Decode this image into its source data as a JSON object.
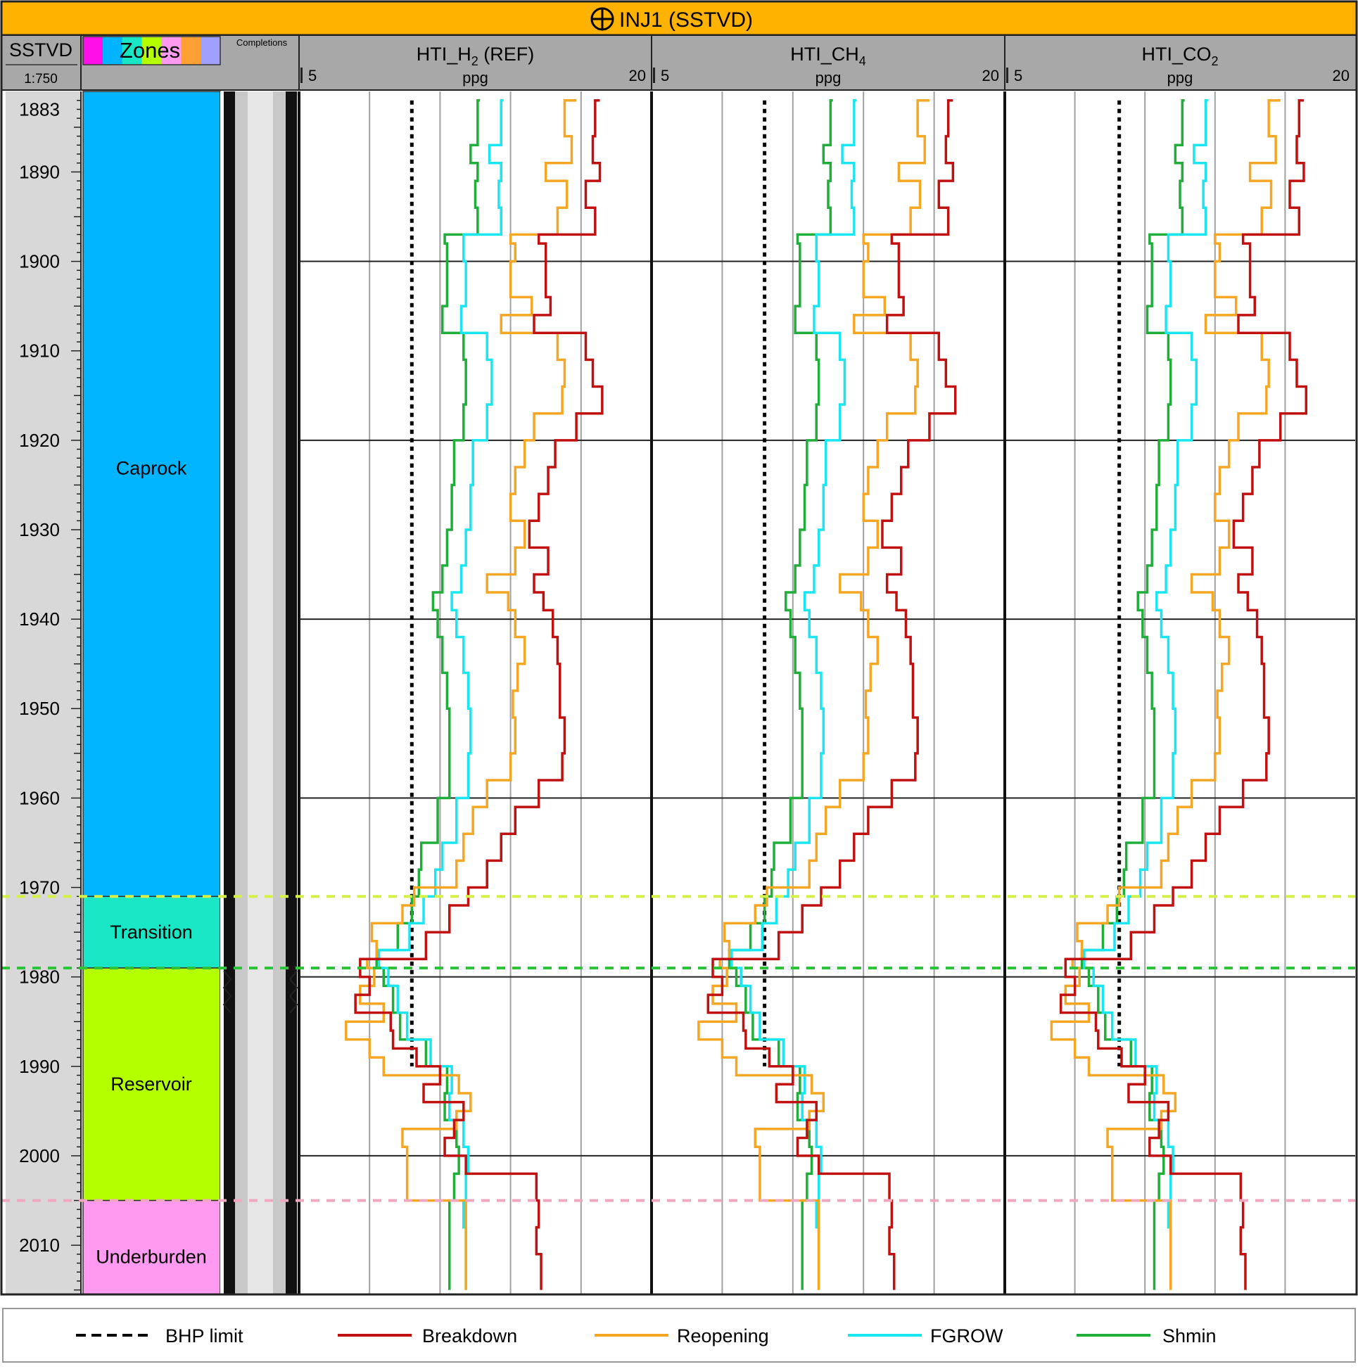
{
  "header": {
    "title": "INJ1 (SSTVD)",
    "color": "#FFB300"
  },
  "depth_track": {
    "label": "SSTVD",
    "scale": "1:750"
  },
  "zones_track": {
    "label": "Zones",
    "swatches": [
      "#FF10E6",
      "#00B4FF",
      "#18E6C4",
      "#B4FF00",
      "#FF9AF0",
      "#FFA033",
      "#A0A0FF"
    ]
  },
  "completions_track": {
    "label": "Completions"
  },
  "tracks": [
    {
      "title_parts": [
        "HTI_H",
        "2",
        " (REF)"
      ],
      "unit": "ppg",
      "min": "5",
      "max": "20"
    },
    {
      "title_parts": [
        "HTI_CH",
        "4",
        ""
      ],
      "unit": "ppg",
      "min": "5",
      "max": "20"
    },
    {
      "title_parts": [
        "HTI_CO",
        "2",
        ""
      ],
      "unit": "ppg",
      "min": "5",
      "max": "20"
    }
  ],
  "legend": [
    {
      "label": "BHP limit",
      "color": "#000000",
      "dashed": true
    },
    {
      "label": "Breakdown",
      "color": "#C01010",
      "dashed": false
    },
    {
      "label": "Reopening",
      "color": "#F5A623",
      "dashed": false
    },
    {
      "label": "FGROW",
      "color": "#19E6F0",
      "dashed": false
    },
    {
      "label": "Shmin",
      "color": "#1FAE3A",
      "dashed": false
    }
  ],
  "chart_data": {
    "type": "line",
    "depth_range": [
      1881,
      2015.5
    ],
    "x_range": [
      5,
      20
    ],
    "depth_ticks": [
      1883,
      1890,
      1900,
      1910,
      1920,
      1930,
      1940,
      1950,
      1960,
      1970,
      1980,
      1990,
      2000,
      2010
    ],
    "zones": [
      {
        "name": "Caprock",
        "top": 1881,
        "bottom": 1971,
        "color": "#00B4FF"
      },
      {
        "name": "Transition",
        "top": 1971,
        "bottom": 1979,
        "color": "#18E6C4"
      },
      {
        "name": "Reservoir",
        "top": 1979,
        "bottom": 2005,
        "color": "#B4FF00"
      },
      {
        "name": "Underburden",
        "top": 2005,
        "bottom": 2015.5,
        "color": "#FF9AF0"
      }
    ],
    "boundaries": [
      {
        "depth": 1971,
        "color": "#D6F04A"
      },
      {
        "depth": 1979,
        "color": "#2EC43A"
      },
      {
        "depth": 2005,
        "color": "#F0A8C0"
      }
    ],
    "bhp_limit": [
      {
        "x": 9.8,
        "top": 1882,
        "bottom": 1990
      },
      {
        "x": 9.8,
        "top": 1882,
        "bottom": 1990
      },
      {
        "x": 9.9,
        "top": 1882,
        "bottom": 1990
      }
    ],
    "series": [
      {
        "name": "Shmin",
        "color": "#1FAE3A",
        "depth": [
          1882,
          1887,
          1889,
          1891,
          1894,
          1897,
          1898,
          1900,
          1905,
          1908,
          1911,
          1916,
          1920,
          1925,
          1930,
          1934,
          1937,
          1939,
          1942,
          1946,
          1950,
          1955,
          1960,
          1965,
          1968,
          1971,
          1974,
          1977,
          1979,
          1981,
          1984,
          1987,
          1990,
          1993,
          1996,
          1999,
          2002,
          2005,
          2008,
          2011,
          2015
        ],
        "values": [
          12.7,
          12.6,
          12.3,
          12.6,
          12.5,
          12.6,
          11.2,
          11.3,
          11.3,
          11.1,
          12.0,
          12.1,
          12.0,
          11.6,
          11.5,
          11.3,
          11.1,
          10.7,
          10.9,
          11.1,
          11.3,
          11.4,
          11.4,
          10.9,
          10.2,
          10.1,
          9.8,
          9.2,
          8.3,
          8.6,
          9.0,
          9.3,
          10.4,
          11.3,
          11.2,
          11.7,
          11.8,
          11.6,
          11.4,
          11.4,
          11.4
        ]
      },
      {
        "name": "FGROW",
        "color": "#19E6F0",
        "depth": [
          1882,
          1887,
          1889,
          1891,
          1894,
          1897,
          1898,
          1900,
          1905,
          1908,
          1911,
          1916,
          1920,
          1925,
          1930,
          1934,
          1937,
          1939,
          1942,
          1946,
          1950,
          1955,
          1960,
          1965,
          1968,
          1971,
          1974,
          1977,
          1979,
          1981,
          1984,
          1987,
          1990,
          1993,
          1996,
          1999,
          2002,
          2005,
          2008,
          2011,
          2015
        ],
        "values": [
          13.7,
          13.6,
          13.1,
          13.6,
          13.5,
          13.6,
          12.0,
          12.0,
          12.1,
          11.9,
          13.0,
          13.2,
          13.0,
          12.4,
          12.3,
          12.1,
          11.9,
          11.5,
          11.7,
          12.0,
          12.2,
          12.3,
          12.2,
          11.7,
          11.1,
          10.8,
          10.3,
          9.7,
          8.4,
          8.8,
          9.2,
          9.6,
          10.6,
          11.5,
          11.4,
          12.0,
          12.2,
          12.1,
          12.0,
          12.1,
          12.1
        ]
      },
      {
        "name": "Reopening",
        "color": "#F5A623",
        "depth": [
          1882,
          1886,
          1889,
          1891,
          1894,
          1897,
          1898,
          1900,
          1904,
          1906,
          1908,
          1911,
          1914,
          1917,
          1920,
          1923,
          1926,
          1929,
          1932,
          1935,
          1937,
          1939,
          1942,
          1945,
          1948,
          1951,
          1955,
          1958,
          1961,
          1964,
          1967,
          1970,
          1972,
          1974,
          1976,
          1978,
          1979,
          1981,
          1983,
          1985,
          1987,
          1989,
          1991,
          1993,
          1995,
          1997,
          1999,
          2002,
          2005,
          2008,
          2011,
          2015
        ],
        "values": [
          16.8,
          16.3,
          16.6,
          15.5,
          16.4,
          16.0,
          14.0,
          14.2,
          14.0,
          14.9,
          13.6,
          16.0,
          16.3,
          16.2,
          15.0,
          14.6,
          14.2,
          14.0,
          14.6,
          14.2,
          13.0,
          13.9,
          14.2,
          14.6,
          14.3,
          14.1,
          14.2,
          14.0,
          13.0,
          12.4,
          12.0,
          11.7,
          9.9,
          9.4,
          8.1,
          8.3,
          7.9,
          8.2,
          7.6,
          8.6,
          7.0,
          8.0,
          8.6,
          11.8,
          12.3,
          11.7,
          9.4,
          9.6,
          9.6,
          12.1,
          12.1,
          12.1
        ]
      },
      {
        "name": "Breakdown",
        "color": "#C01010",
        "depth": [
          1882,
          1886,
          1889,
          1891,
          1894,
          1897,
          1898,
          1900,
          1904,
          1906,
          1908,
          1911,
          1914,
          1917,
          1920,
          1923,
          1926,
          1929,
          1932,
          1935,
          1937,
          1939,
          1942,
          1945,
          1948,
          1951,
          1955,
          1958,
          1961,
          1964,
          1967,
          1970,
          1972,
          1975,
          1978,
          1980,
          1982,
          1984,
          1986,
          1988,
          1990,
          1992,
          1994,
          1996,
          1998,
          2000,
          2002,
          2005,
          2008,
          2011,
          2015
        ],
        "values": [
          17.8,
          17.6,
          17.5,
          17.8,
          17.2,
          17.6,
          15.2,
          15.5,
          15.5,
          15.7,
          15.0,
          17.2,
          17.5,
          17.9,
          16.8,
          15.9,
          15.6,
          15.2,
          14.8,
          15.6,
          15.0,
          15.4,
          15.8,
          16.0,
          16.1,
          16.1,
          16.3,
          16.2,
          15.2,
          14.2,
          13.6,
          13.0,
          12.2,
          11.4,
          10.4,
          7.6,
          8.0,
          7.4,
          8.9,
          9.0,
          10.0,
          11.0,
          10.3,
          12.0,
          11.6,
          11.2,
          12.1,
          15.1,
          15.2,
          15.1,
          15.3
        ]
      }
    ]
  }
}
